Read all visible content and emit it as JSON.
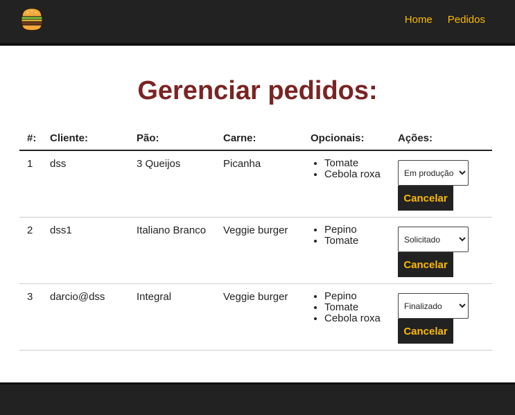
{
  "nav": {
    "logo_icon": "hamburger-icon",
    "links": [
      "Home",
      "Pedidos"
    ]
  },
  "title": "Gerenciar pedidos:",
  "table": {
    "headers": [
      "#:",
      "Cliente:",
      "Pão:",
      "Carne:",
      "Opcionais:",
      "Ações:"
    ],
    "rows": [
      {
        "id": "1",
        "client": "dss",
        "bread": "3 Queijos",
        "meat": "Picanha",
        "optionals": [
          "Tomate",
          "Cebola roxa"
        ],
        "status": "Em produção",
        "cancel": "Cancelar"
      },
      {
        "id": "2",
        "client": "dss1",
        "bread": "Italiano Branco",
        "meat": "Veggie burger",
        "optionals": [
          "Pepino",
          "Tomate"
        ],
        "status": "Solicitado",
        "cancel": "Cancelar"
      },
      {
        "id": "3",
        "client": "darcio@dss",
        "bread": "Integral",
        "meat": "Veggie burger",
        "optionals": [
          "Pepino",
          "Tomate",
          "Cebola roxa"
        ],
        "status": "Finalizado",
        "cancel": "Cancelar"
      }
    ]
  },
  "colors": {
    "nav_bg": "#222222",
    "accent": "#fcba03",
    "title": "#7b2323"
  }
}
